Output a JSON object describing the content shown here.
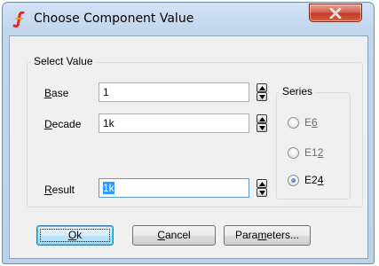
{
  "window": {
    "title": "Choose Component Value",
    "colors": {
      "accent": "#3399ff",
      "close_button": "#c13b26"
    }
  },
  "select_value": {
    "group_label": "Select Value",
    "base": {
      "label_mnemonic": "B",
      "label_rest": "ase",
      "value": "1"
    },
    "decade": {
      "label_mnemonic": "D",
      "label_rest": "ecade",
      "value": "1k"
    },
    "result": {
      "label_mnemonic": "R",
      "label_rest": "esult",
      "value": "1k"
    }
  },
  "series": {
    "group_label": "Series",
    "options": [
      {
        "prefix": "E",
        "digit1": "6",
        "digit2": "",
        "mnemonic_index": 1,
        "selected": false
      },
      {
        "prefix": "E",
        "digit1": "1",
        "digit2": "2",
        "mnemonic_index": 2,
        "selected": false
      },
      {
        "prefix": "E",
        "digit1": "2",
        "digit2": "4",
        "mnemonic_index": 2,
        "selected": true
      }
    ]
  },
  "buttons": {
    "ok": {
      "mnemonic": "O",
      "rest": "k"
    },
    "cancel": {
      "mnemonic": "C",
      "rest": "ancel"
    },
    "parameters": {
      "before": "Para",
      "mnemonic": "m",
      "after": "eters..."
    }
  },
  "icons": {
    "app": "simetrix-logo-icon",
    "close": "close-icon",
    "spin_up": "spin-up-icon",
    "spin_down": "spin-down-icon"
  }
}
